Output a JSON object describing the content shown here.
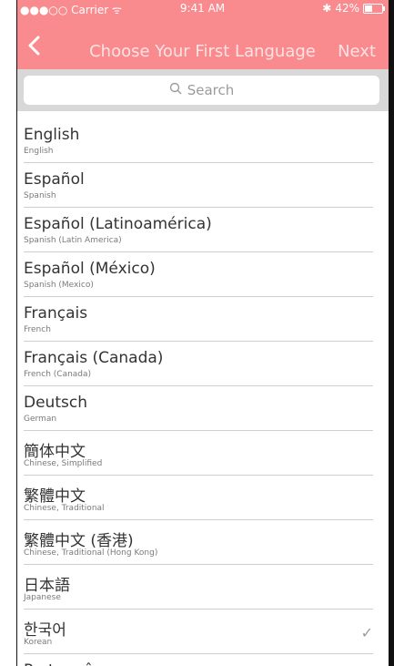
{
  "status": {
    "carrier": "●●●○○ Carrier ᯤ",
    "time": "9:41 AM",
    "battery_pct": "42%",
    "bluetooth_icon": "bluetooth-icon"
  },
  "nav": {
    "title": "Choose Your First Language",
    "next": "Next",
    "back_icon": "chevron-left-icon"
  },
  "search": {
    "placeholder": "Search",
    "icon": "search-icon"
  },
  "colors": {
    "accent": "#f98b8f",
    "search_bg": "#d8d8d8"
  },
  "languages": [
    {
      "name": "English",
      "sub": "English"
    },
    {
      "name": "Español",
      "sub": "Spanish"
    },
    {
      "name": "Español (Latinoamérica)",
      "sub": "Spanish (Latin America)"
    },
    {
      "name": "Español (México)",
      "sub": "Spanish (Mexico)"
    },
    {
      "name": "Français",
      "sub": "French"
    },
    {
      "name": "Français (Canada)",
      "sub": "French (Canada)"
    },
    {
      "name": "Deutsch",
      "sub": "German"
    },
    {
      "name": "簡体中文",
      "sub": "Chinese, Simplified"
    },
    {
      "name": "繁體中文",
      "sub": "Chinese, Traditional"
    },
    {
      "name": "繁體中文 (香港)",
      "sub": "Chinese, Traditional (Hong Kong)"
    },
    {
      "name": "日本語",
      "sub": "Japanese"
    },
    {
      "name": "한국어",
      "sub": "Korean",
      "selected_mark": "✓"
    },
    {
      "name": "Português",
      "sub": ""
    }
  ]
}
